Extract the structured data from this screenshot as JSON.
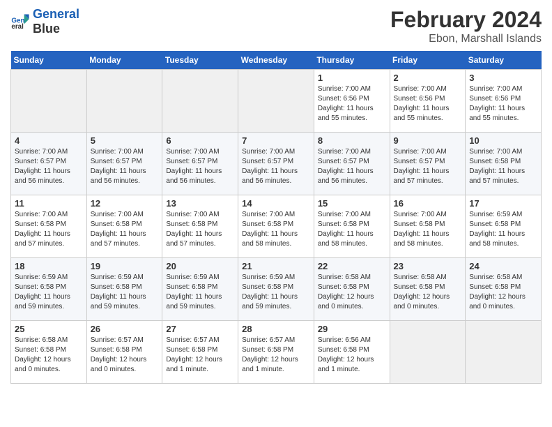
{
  "header": {
    "logo_general": "General",
    "logo_blue": "Blue",
    "main_title": "February 2024",
    "subtitle": "Ebon, Marshall Islands"
  },
  "days_of_week": [
    "Sunday",
    "Monday",
    "Tuesday",
    "Wednesday",
    "Thursday",
    "Friday",
    "Saturday"
  ],
  "weeks": [
    [
      {
        "day": "",
        "empty": true
      },
      {
        "day": "",
        "empty": true
      },
      {
        "day": "",
        "empty": true
      },
      {
        "day": "",
        "empty": true
      },
      {
        "day": "1",
        "sunrise": "7:00 AM",
        "sunset": "6:56 PM",
        "daylight": "11 hours and 55 minutes."
      },
      {
        "day": "2",
        "sunrise": "7:00 AM",
        "sunset": "6:56 PM",
        "daylight": "11 hours and 55 minutes."
      },
      {
        "day": "3",
        "sunrise": "7:00 AM",
        "sunset": "6:56 PM",
        "daylight": "11 hours and 55 minutes."
      }
    ],
    [
      {
        "day": "4",
        "sunrise": "7:00 AM",
        "sunset": "6:57 PM",
        "daylight": "11 hours and 56 minutes."
      },
      {
        "day": "5",
        "sunrise": "7:00 AM",
        "sunset": "6:57 PM",
        "daylight": "11 hours and 56 minutes."
      },
      {
        "day": "6",
        "sunrise": "7:00 AM",
        "sunset": "6:57 PM",
        "daylight": "11 hours and 56 minutes."
      },
      {
        "day": "7",
        "sunrise": "7:00 AM",
        "sunset": "6:57 PM",
        "daylight": "11 hours and 56 minutes."
      },
      {
        "day": "8",
        "sunrise": "7:00 AM",
        "sunset": "6:57 PM",
        "daylight": "11 hours and 56 minutes."
      },
      {
        "day": "9",
        "sunrise": "7:00 AM",
        "sunset": "6:57 PM",
        "daylight": "11 hours and 57 minutes."
      },
      {
        "day": "10",
        "sunrise": "7:00 AM",
        "sunset": "6:58 PM",
        "daylight": "11 hours and 57 minutes."
      }
    ],
    [
      {
        "day": "11",
        "sunrise": "7:00 AM",
        "sunset": "6:58 PM",
        "daylight": "11 hours and 57 minutes."
      },
      {
        "day": "12",
        "sunrise": "7:00 AM",
        "sunset": "6:58 PM",
        "daylight": "11 hours and 57 minutes."
      },
      {
        "day": "13",
        "sunrise": "7:00 AM",
        "sunset": "6:58 PM",
        "daylight": "11 hours and 57 minutes."
      },
      {
        "day": "14",
        "sunrise": "7:00 AM",
        "sunset": "6:58 PM",
        "daylight": "11 hours and 58 minutes."
      },
      {
        "day": "15",
        "sunrise": "7:00 AM",
        "sunset": "6:58 PM",
        "daylight": "11 hours and 58 minutes."
      },
      {
        "day": "16",
        "sunrise": "7:00 AM",
        "sunset": "6:58 PM",
        "daylight": "11 hours and 58 minutes."
      },
      {
        "day": "17",
        "sunrise": "6:59 AM",
        "sunset": "6:58 PM",
        "daylight": "11 hours and 58 minutes."
      }
    ],
    [
      {
        "day": "18",
        "sunrise": "6:59 AM",
        "sunset": "6:58 PM",
        "daylight": "11 hours and 59 minutes."
      },
      {
        "day": "19",
        "sunrise": "6:59 AM",
        "sunset": "6:58 PM",
        "daylight": "11 hours and 59 minutes."
      },
      {
        "day": "20",
        "sunrise": "6:59 AM",
        "sunset": "6:58 PM",
        "daylight": "11 hours and 59 minutes."
      },
      {
        "day": "21",
        "sunrise": "6:59 AM",
        "sunset": "6:58 PM",
        "daylight": "11 hours and 59 minutes."
      },
      {
        "day": "22",
        "sunrise": "6:58 AM",
        "sunset": "6:58 PM",
        "daylight": "12 hours and 0 minutes."
      },
      {
        "day": "23",
        "sunrise": "6:58 AM",
        "sunset": "6:58 PM",
        "daylight": "12 hours and 0 minutes."
      },
      {
        "day": "24",
        "sunrise": "6:58 AM",
        "sunset": "6:58 PM",
        "daylight": "12 hours and 0 minutes."
      }
    ],
    [
      {
        "day": "25",
        "sunrise": "6:58 AM",
        "sunset": "6:58 PM",
        "daylight": "12 hours and 0 minutes."
      },
      {
        "day": "26",
        "sunrise": "6:57 AM",
        "sunset": "6:58 PM",
        "daylight": "12 hours and 0 minutes."
      },
      {
        "day": "27",
        "sunrise": "6:57 AM",
        "sunset": "6:58 PM",
        "daylight": "12 hours and 1 minute."
      },
      {
        "day": "28",
        "sunrise": "6:57 AM",
        "sunset": "6:58 PM",
        "daylight": "12 hours and 1 minute."
      },
      {
        "day": "29",
        "sunrise": "6:56 AM",
        "sunset": "6:58 PM",
        "daylight": "12 hours and 1 minute."
      },
      {
        "day": "",
        "empty": true
      },
      {
        "day": "",
        "empty": true
      }
    ]
  ]
}
